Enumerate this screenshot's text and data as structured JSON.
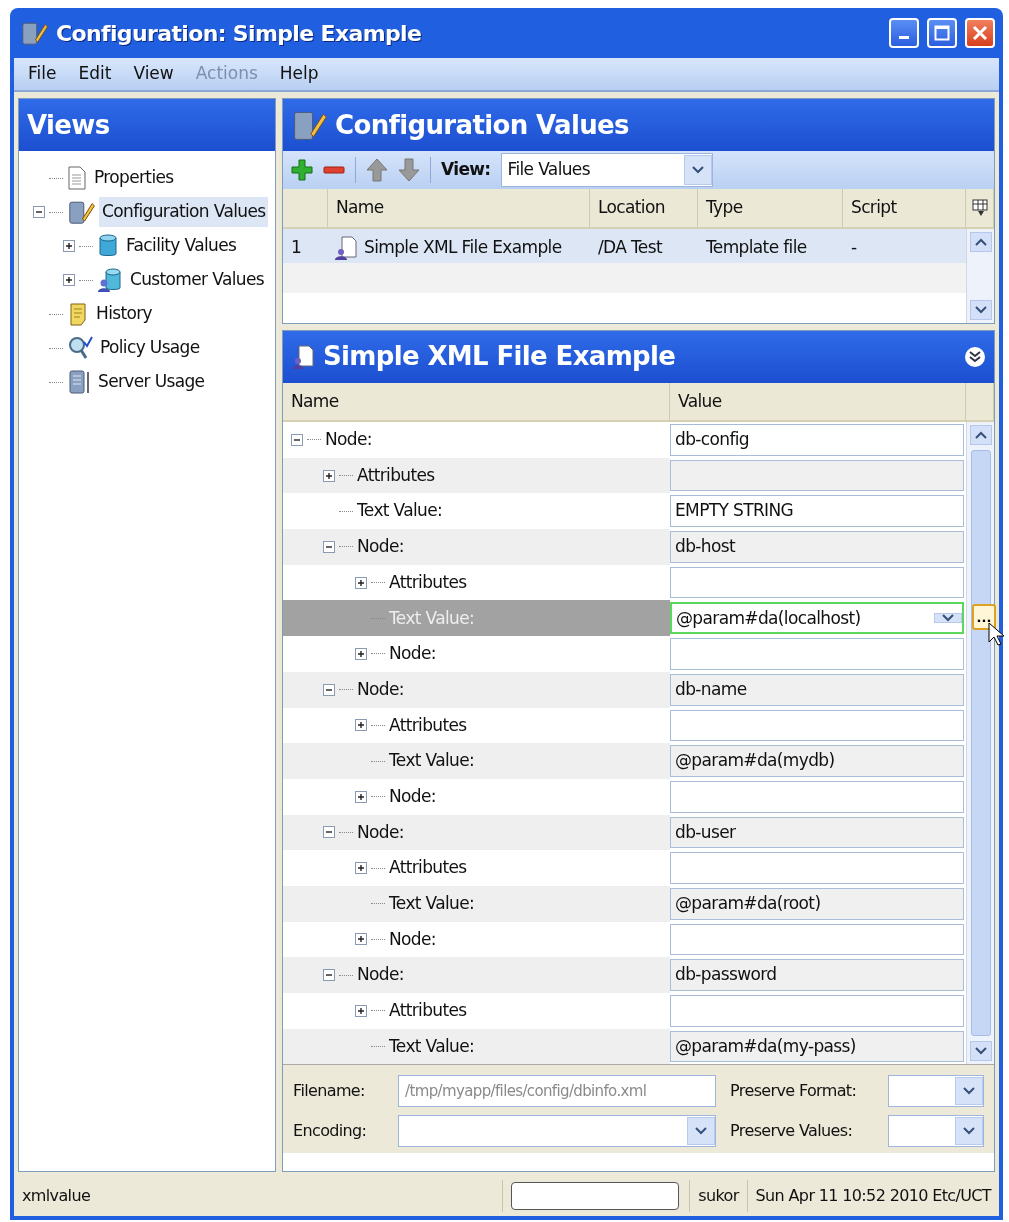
{
  "window": {
    "title": "Configuration: Simple Example"
  },
  "menu": [
    {
      "label": "File",
      "disabled": false
    },
    {
      "label": "Edit",
      "disabled": false
    },
    {
      "label": "View",
      "disabled": false
    },
    {
      "label": "Actions",
      "disabled": true
    },
    {
      "label": "Help",
      "disabled": false
    }
  ],
  "views": {
    "title": "Views",
    "tree": [
      {
        "label": "Properties",
        "selected": false
      },
      {
        "label": "Configuration Values",
        "selected": true,
        "expanded": true,
        "children": [
          {
            "label": "Facility Values",
            "selected": false,
            "expanded": false
          },
          {
            "label": "Customer Values",
            "selected": false,
            "expanded": false
          }
        ]
      },
      {
        "label": "History",
        "selected": false
      },
      {
        "label": "Policy Usage",
        "selected": false
      },
      {
        "label": "Server Usage",
        "selected": false
      }
    ]
  },
  "config_values": {
    "title": "Configuration Values",
    "view_label": "View:",
    "view_value": "File Values",
    "columns": [
      "Name",
      "Location",
      "Type",
      "Script"
    ],
    "rows": [
      {
        "number": "1",
        "name": "Simple XML File Example",
        "location": "/DA Test",
        "type": "Template file",
        "script": "-",
        "selected": true
      }
    ]
  },
  "xml_panel": {
    "title": "Simple XML File Example",
    "columns": [
      "Name",
      "Value"
    ],
    "ellipsis_button": "...",
    "tree": [
      {
        "label": "Node:",
        "value": "db-config",
        "expanded": true,
        "selected": false,
        "children": [
          {
            "label": "Attributes",
            "expanded": false,
            "selected": false
          },
          {
            "label": "Text Value:",
            "value": "EMPTY STRING",
            "selected": false
          },
          {
            "label": "Node:",
            "value": "db-host",
            "expanded": true,
            "selected": false,
            "children": [
              {
                "label": "Attributes",
                "expanded": false,
                "selected": false
              },
              {
                "label": "Text Value:",
                "value": "@param#da(localhost)",
                "selected": true
              },
              {
                "label": "Node:",
                "expanded": false,
                "selected": false
              }
            ]
          },
          {
            "label": "Node:",
            "value": "db-name",
            "expanded": true,
            "selected": false,
            "children": [
              {
                "label": "Attributes",
                "expanded": false,
                "selected": false
              },
              {
                "label": "Text Value:",
                "value": "@param#da(mydb)",
                "selected": false
              },
              {
                "label": "Node:",
                "expanded": false,
                "selected": false
              }
            ]
          },
          {
            "label": "Node:",
            "value": "db-user",
            "expanded": true,
            "selected": false,
            "children": [
              {
                "label": "Attributes",
                "expanded": false,
                "selected": false
              },
              {
                "label": "Text Value:",
                "value": "@param#da(root)",
                "selected": false
              },
              {
                "label": "Node:",
                "expanded": false,
                "selected": false
              }
            ]
          },
          {
            "label": "Node:",
            "value": "db-password",
            "expanded": true,
            "selected": false,
            "children": [
              {
                "label": "Attributes",
                "expanded": false,
                "selected": false
              },
              {
                "label": "Text Value:",
                "value": "@param#da(my-pass)",
                "selected": false
              }
            ]
          }
        ]
      }
    ]
  },
  "form": {
    "filename_label": "Filename:",
    "filename": "/tmp/myapp/files/config/dbinfo.xml",
    "filename_disabled": true,
    "encoding_label": "Encoding:",
    "preserve_format_label": "Preserve Format:",
    "preserve_values_label": "Preserve Values:"
  },
  "status_bar": {
    "message": "xmlvalue",
    "user": "sukor",
    "time": "Sun Apr 11 10:52 2010 Etc/UCT"
  }
}
